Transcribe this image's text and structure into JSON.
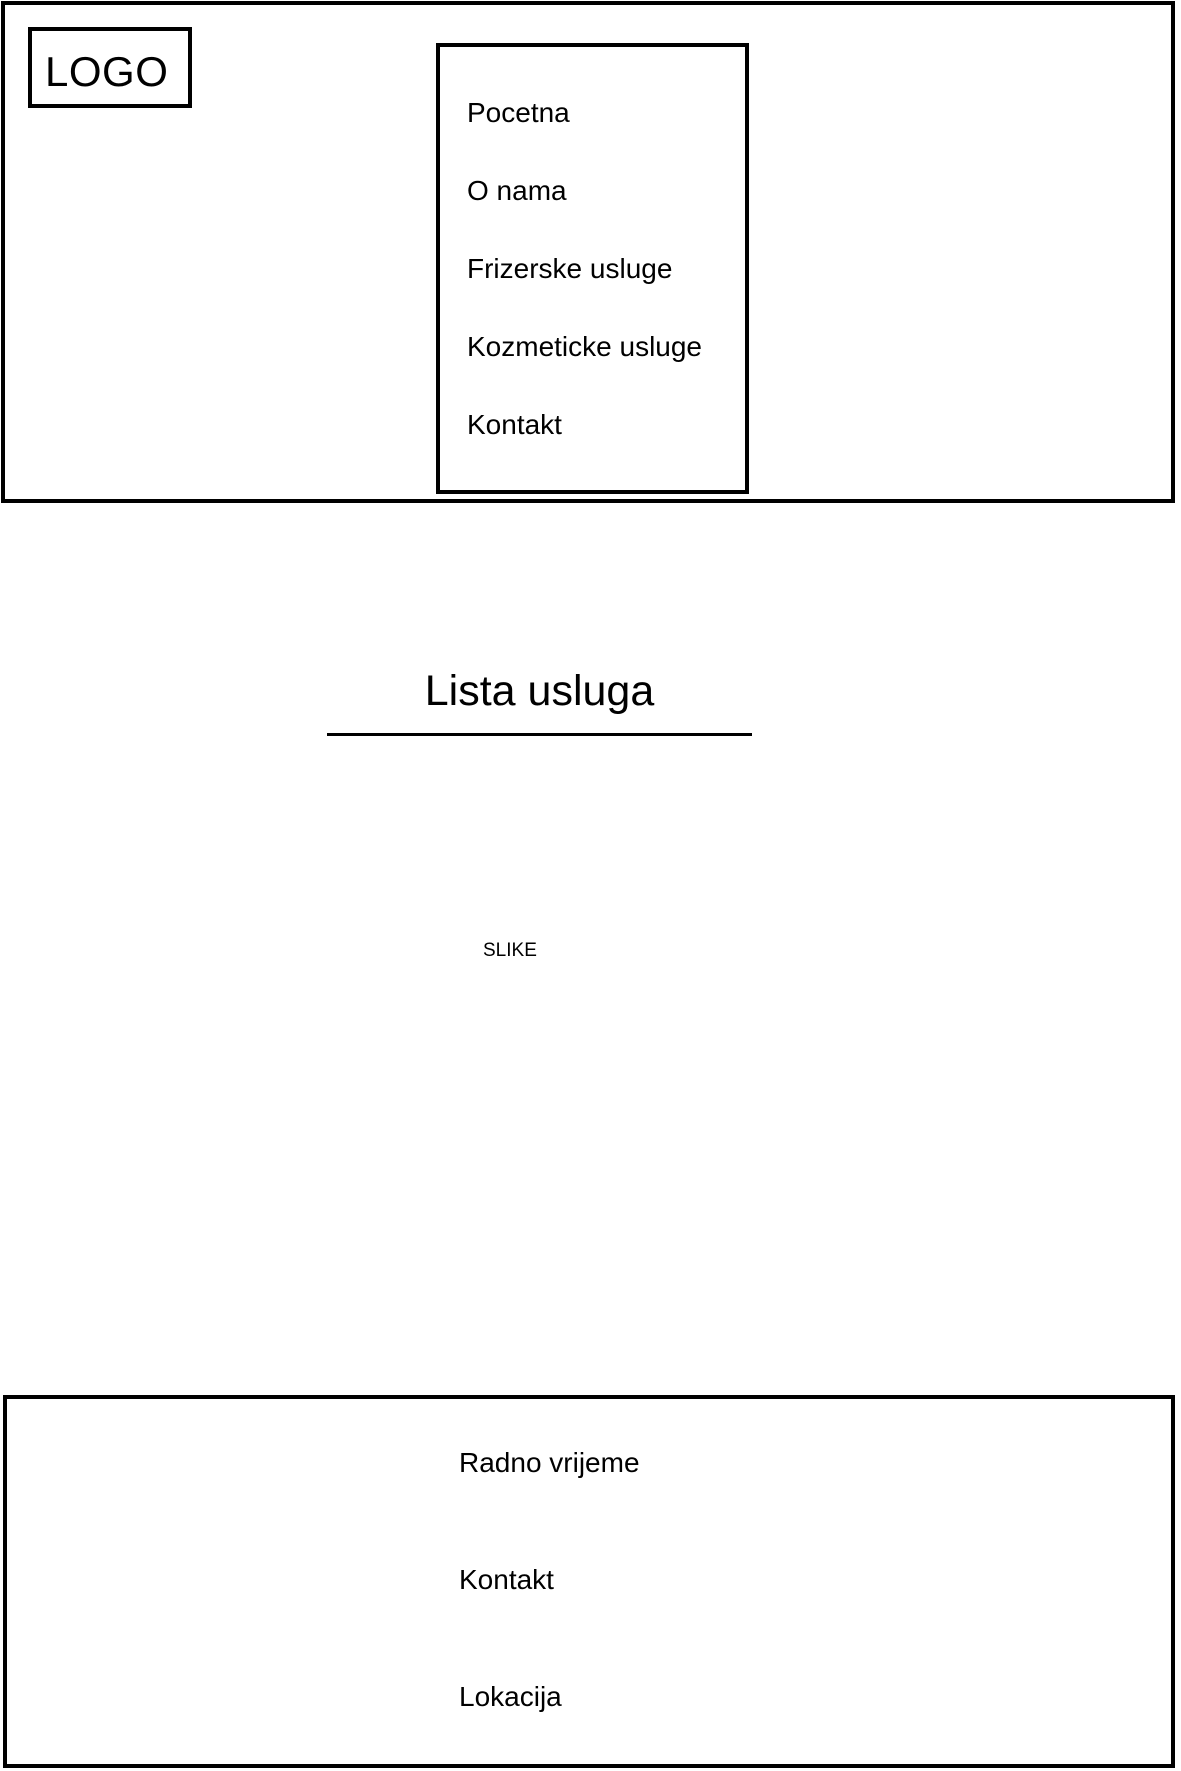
{
  "header": {
    "logo_text": "LOGO",
    "nav": [
      {
        "label": "Pocetna"
      },
      {
        "label": "O nama"
      },
      {
        "label": "Frizerske usluge"
      },
      {
        "label": "Kozmeticke usluge"
      },
      {
        "label": "Kontakt"
      }
    ]
  },
  "main": {
    "title": "Lista usluga",
    "images_placeholder": "SLIKE"
  },
  "footer": {
    "items": [
      {
        "label": "Radno vrijeme"
      },
      {
        "label": "Kontakt"
      },
      {
        "label": "Lokacija"
      }
    ]
  }
}
